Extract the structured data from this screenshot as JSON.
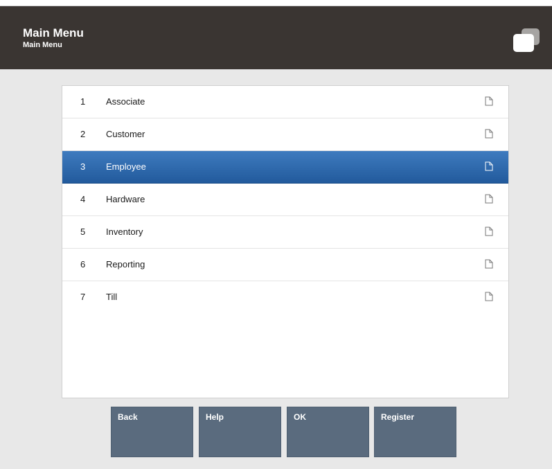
{
  "header": {
    "title": "Main Menu",
    "subtitle": "Main Menu",
    "icon": "window-copy-icon"
  },
  "menu": {
    "selected_index": 2,
    "items": [
      {
        "num": "1",
        "label": "Associate"
      },
      {
        "num": "2",
        "label": "Customer"
      },
      {
        "num": "3",
        "label": "Employee"
      },
      {
        "num": "4",
        "label": "Hardware"
      },
      {
        "num": "5",
        "label": "Inventory"
      },
      {
        "num": "6",
        "label": "Reporting"
      },
      {
        "num": "7",
        "label": "Till"
      }
    ]
  },
  "buttons": {
    "back": "Back",
    "help": "Help",
    "ok": "OK",
    "register": "Register"
  },
  "colors": {
    "header_bg": "#3a3532",
    "selected_row": "#2b65a8",
    "button_bg": "#5a6b7e",
    "app_bg": "#e8e8e8"
  }
}
